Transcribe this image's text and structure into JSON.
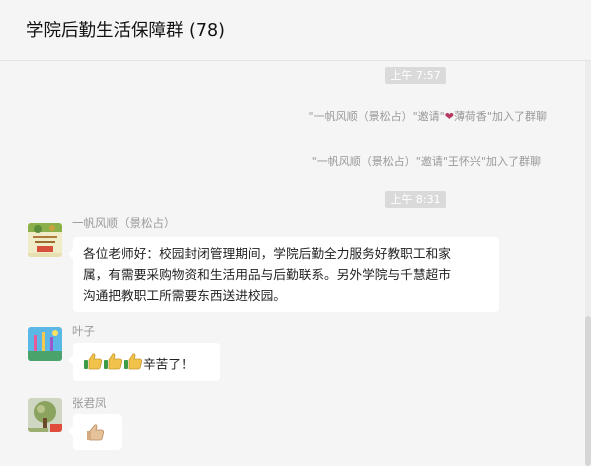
{
  "header": {
    "title": "学院后勤生活保障群 (78)"
  },
  "messages": [
    {
      "type": "time",
      "text": "上午 7:57"
    },
    {
      "type": "system",
      "prefix": "\"一帆风顺（景松占）\"邀请\"",
      "heart": "❤",
      "suffix": "薄荷香\"加入了群聊"
    },
    {
      "type": "system",
      "text": "\"一帆风顺（景松占）\"邀请\"王怀兴\"加入了群聊"
    },
    {
      "type": "time",
      "text": "上午 8:31"
    },
    {
      "type": "chat",
      "sender": "一帆风顺（景松占）",
      "lines": [
        "各位老师好：校园封闭管理期间，学院后勤全力服务好教职工和家",
        "属，有需要采购物资和生活用品与后勤联系。另外学院与千慧超市",
        "沟通把教职工所需要东西送进校园。"
      ]
    },
    {
      "type": "chat",
      "sender": "叶子",
      "text": "辛苦了！",
      "emoji": [
        "thumbs-up-icon",
        "thumbs-up-icon",
        "thumbs-up-icon"
      ]
    },
    {
      "type": "chat",
      "sender": "张君凤",
      "emoji": [
        "thumbs-up-icon"
      ]
    }
  ],
  "colors": {
    "background": "#f5f5f5",
    "bubble": "#ffffff",
    "time_badge": "#dadada",
    "system_text": "#999999"
  }
}
